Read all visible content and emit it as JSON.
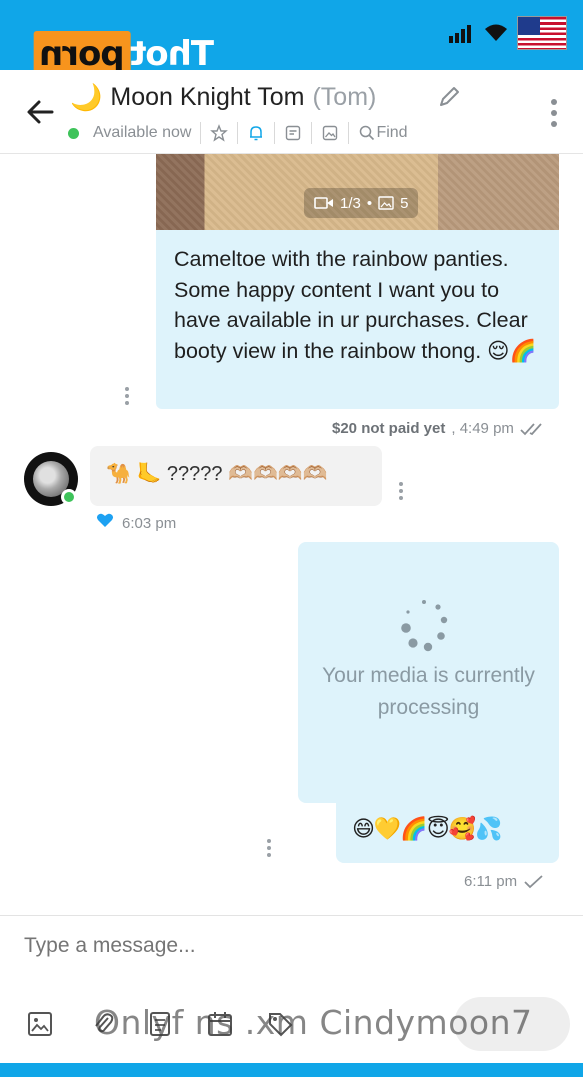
{
  "watermark": {
    "logo_part1": "porn",
    "logo_part2": "Thot",
    "bottom_text": "Onlyf ns .xm Cindymoon7"
  },
  "status_bar": {
    "icons": [
      "signal-icon",
      "wifi-icon",
      "us-flag-icon"
    ]
  },
  "header": {
    "emoji": "🌙",
    "name": "Moon Knight Tom",
    "alias": "(Tom)",
    "status": "Available now",
    "find_label": "Find",
    "colors": {
      "online": "#3ec35a",
      "accent": "#10a6e8"
    }
  },
  "messages": [
    {
      "direction": "outgoing",
      "media_counter": "1/3",
      "media_photos": "5",
      "text": "Cameltoe with the rainbow panties. Some happy content I want you to have available in ur purchases. Clear booty view in the rainbow thong. 😌🌈",
      "price": "$20 not paid yet",
      "time": ", 4:49 pm"
    },
    {
      "direction": "incoming",
      "text": "🐪 🦶 ????? 🫶🏼🫶🏼🫶🏼🫶🏼",
      "time": "6:03 pm"
    },
    {
      "direction": "outgoing",
      "processing_text": "Your media is currently processing",
      "emojis": "😄💛🌈😇🥰💦",
      "time": "6:11 pm"
    }
  ],
  "composer": {
    "placeholder": "Type a message..."
  }
}
